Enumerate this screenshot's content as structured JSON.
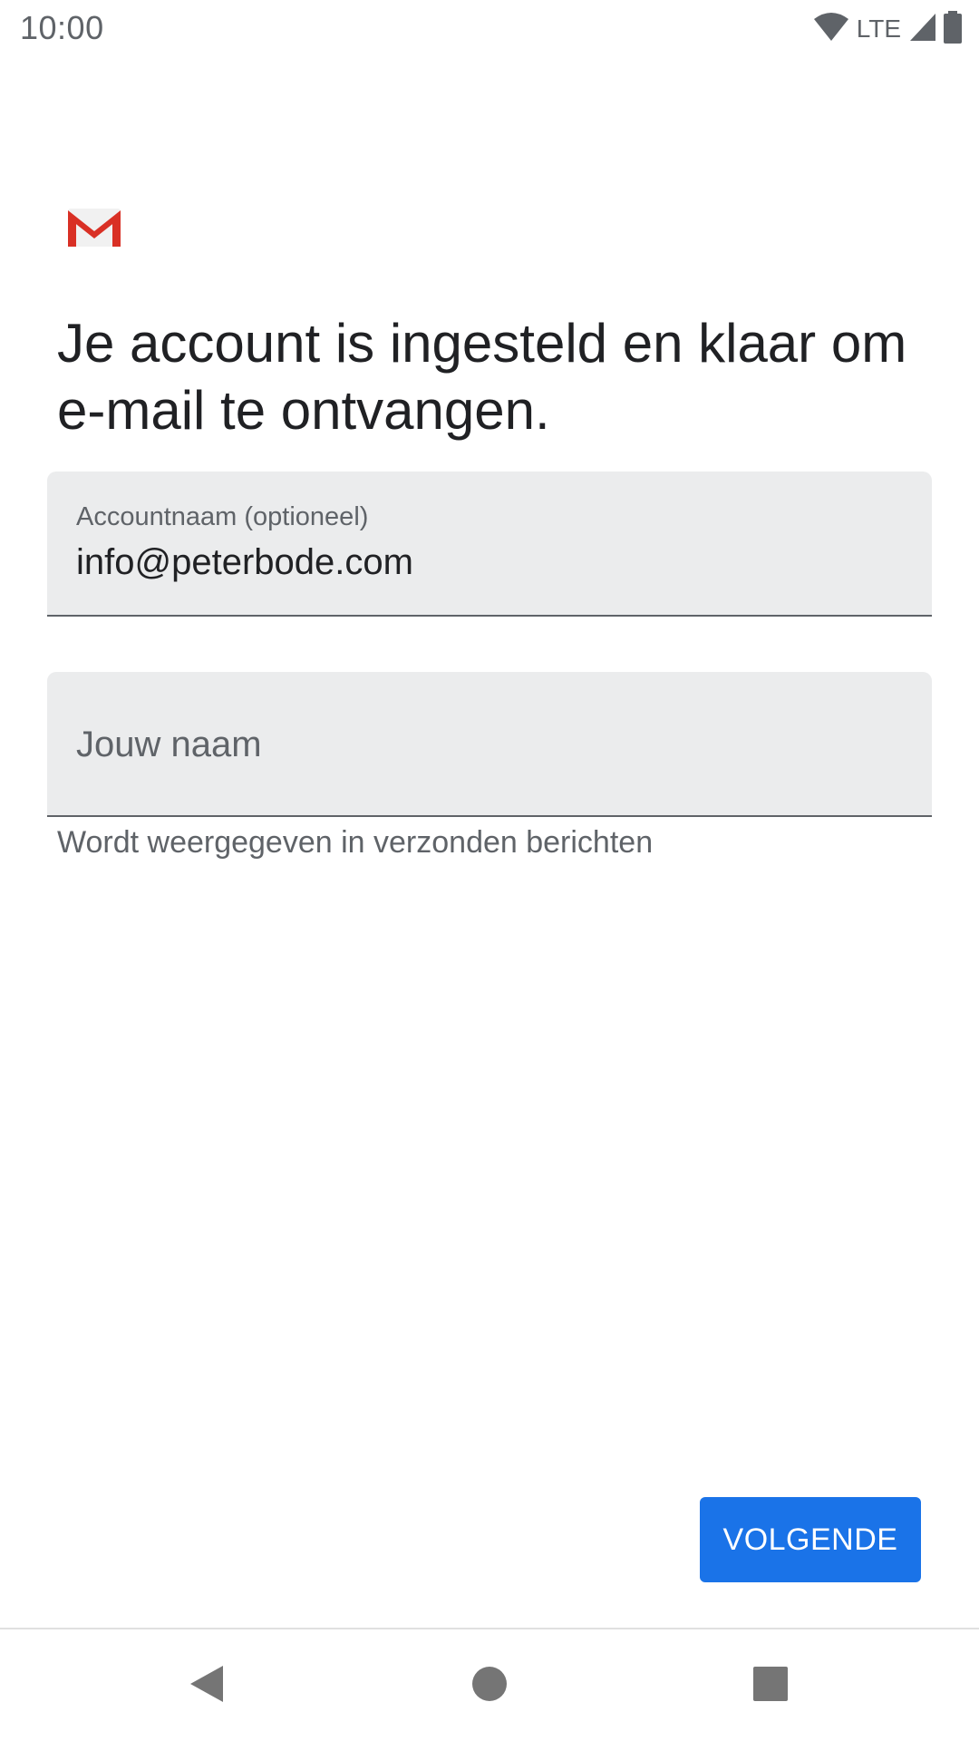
{
  "status_bar": {
    "time": "10:00",
    "network": "LTE",
    "icons": [
      "wifi-icon",
      "signal-icon",
      "battery-icon"
    ]
  },
  "app": {
    "logo": "gmail-logo",
    "headline": "Je account is ingesteld en klaar om e-mail te ontvangen."
  },
  "account_field": {
    "label": "Accountnaam (optioneel)",
    "value": "info@peterbode.com"
  },
  "name_field": {
    "placeholder": "Jouw naam",
    "value": "",
    "helper": "Wordt weergegeven in verzonden berichten"
  },
  "actions": {
    "next_label": "VOLGENDE"
  },
  "nav_bar": {
    "buttons": [
      "back-icon",
      "home-icon",
      "recents-icon"
    ]
  },
  "colors": {
    "accent": "#1a73e8",
    "field_bg": "#ebeced",
    "text_primary": "#202124",
    "text_secondary": "#5f6368",
    "gmail_red": "#d93025"
  }
}
